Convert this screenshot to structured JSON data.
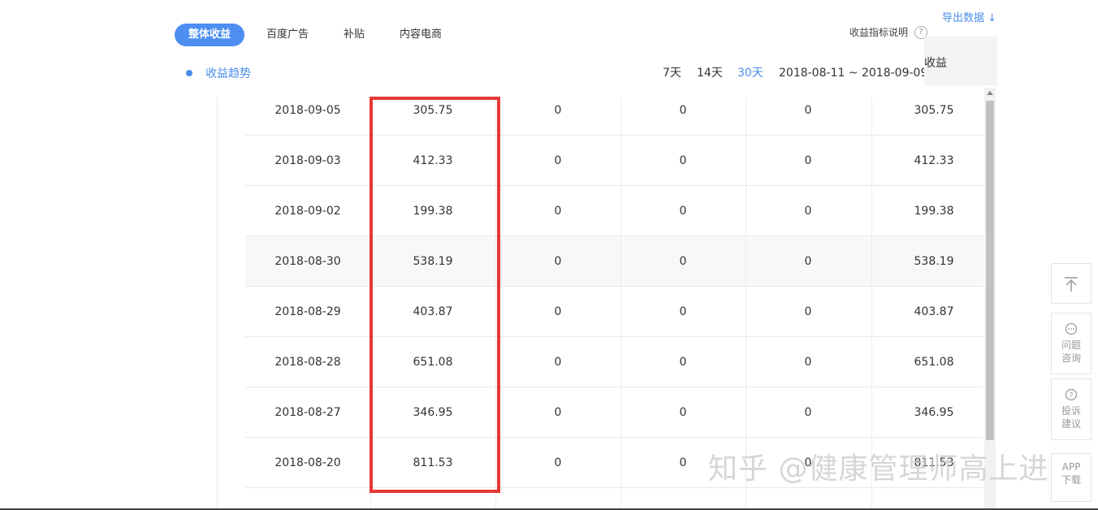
{
  "tabs": [
    {
      "label": "整体收益",
      "active": true
    },
    {
      "label": "百度广告",
      "active": false
    },
    {
      "label": "补贴",
      "active": false
    },
    {
      "label": "内容电商",
      "active": false
    }
  ],
  "export_label": "导出数据 ↓",
  "metrics_label": "收益指标说明",
  "help_glyph": "?",
  "section_title": "收益趋势",
  "ranges": [
    {
      "label": "7天",
      "active": false
    },
    {
      "label": "14天",
      "active": false
    },
    {
      "label": "30天",
      "active": true
    }
  ],
  "date_range": "2018-08-11 ~ 2018-09-09",
  "header_partial": "收益",
  "rows": [
    {
      "date": "2018-09-05",
      "v1": "305.75",
      "v2": "0",
      "v3": "0",
      "v4": "0",
      "total": "305.75"
    },
    {
      "date": "2018-09-03",
      "v1": "412.33",
      "v2": "0",
      "v3": "0",
      "v4": "0",
      "total": "412.33"
    },
    {
      "date": "2018-09-02",
      "v1": "199.38",
      "v2": "0",
      "v3": "0",
      "v4": "0",
      "total": "199.38"
    },
    {
      "date": "2018-08-30",
      "v1": "538.19",
      "v2": "0",
      "v3": "0",
      "v4": "0",
      "total": "538.19"
    },
    {
      "date": "2018-08-29",
      "v1": "403.87",
      "v2": "0",
      "v3": "0",
      "v4": "0",
      "total": "403.87"
    },
    {
      "date": "2018-08-28",
      "v1": "651.08",
      "v2": "0",
      "v3": "0",
      "v4": "0",
      "total": "651.08"
    },
    {
      "date": "2018-08-27",
      "v1": "346.95",
      "v2": "0",
      "v3": "0",
      "v4": "0",
      "total": "346.95"
    },
    {
      "date": "2018-08-20",
      "v1": "811.53",
      "v2": "0",
      "v3": "0",
      "v4": "0",
      "total": "811.53"
    }
  ],
  "sidebar": {
    "top_icon": "arrow-up-to-top-icon",
    "question": [
      "问题",
      "咨询"
    ],
    "complaint": [
      "投诉",
      "建议"
    ],
    "app": [
      "APP",
      "下载"
    ]
  },
  "watermark": "知乎 @健康管理师高上进",
  "colors": {
    "accent": "#4d8ef0",
    "highlight_box": "#e53935",
    "row_alt": "#f8f8f8"
  }
}
